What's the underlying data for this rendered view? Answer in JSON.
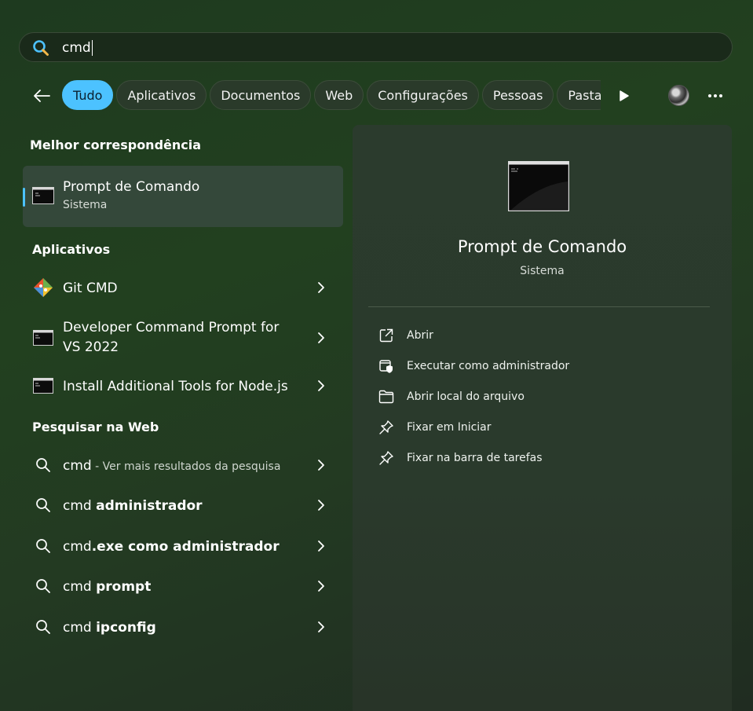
{
  "search": {
    "query": "cmd"
  },
  "filters": {
    "back_label": "Voltar",
    "chips": [
      "Tudo",
      "Aplicativos",
      "Documentos",
      "Web",
      "Configurações",
      "Pessoas",
      "Pasta"
    ]
  },
  "best_match": {
    "heading": "Melhor correspondência",
    "title": "Prompt de Comando",
    "subtitle": "Sistema"
  },
  "apps": {
    "heading": "Aplicativos",
    "items": [
      {
        "label": "Git CMD",
        "icon": "git-icon"
      },
      {
        "label": "Developer Command Prompt for VS 2022",
        "icon": "console-icon"
      },
      {
        "label": "Install Additional Tools for Node.js",
        "icon": "console-icon"
      }
    ]
  },
  "web": {
    "heading": "Pesquisar na Web",
    "items": [
      {
        "prefix": "cmd",
        "bold": "",
        "suffix": " - Ver mais resultados da pesquisa"
      },
      {
        "prefix": "cmd ",
        "bold": "administrador",
        "suffix": ""
      },
      {
        "prefix": "cmd",
        "bold": ".exe como administrador",
        "suffix": ""
      },
      {
        "prefix": "cmd ",
        "bold": "prompt",
        "suffix": ""
      },
      {
        "prefix": "cmd ",
        "bold": "ipconfig",
        "suffix": ""
      }
    ]
  },
  "preview": {
    "title": "Prompt de Comando",
    "subtitle": "Sistema",
    "actions": [
      {
        "label": "Abrir",
        "icon": "open-external-icon"
      },
      {
        "label": "Executar como administrador",
        "icon": "shield-admin-icon"
      },
      {
        "label": "Abrir local do arquivo",
        "icon": "folder-icon"
      },
      {
        "label": "Fixar em Iniciar",
        "icon": "pin-icon"
      },
      {
        "label": "Fixar na barra de tarefas",
        "icon": "pin-icon"
      }
    ]
  },
  "colors": {
    "accent": "#4cc2ff",
    "background": "#22401f"
  }
}
